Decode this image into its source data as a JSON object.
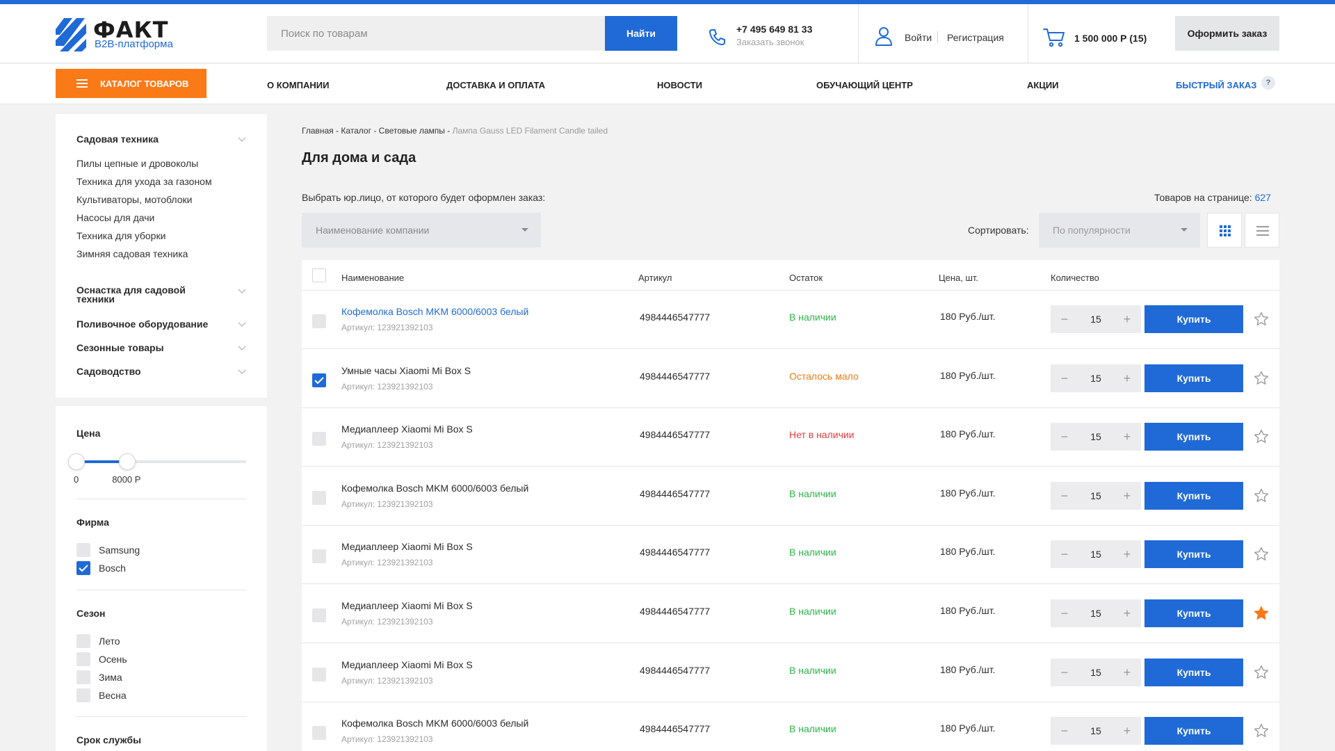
{
  "header": {
    "logo_word": "ФАКТ",
    "logo_sub": "B2B-платформа",
    "search_placeholder": "Поиск по товарам",
    "search_button": "Найти",
    "phone": "+7 495 649 81 33",
    "callback": "Заказать звонок",
    "login": "Войти",
    "register": "Регистрация",
    "cart_summary": "1 500 000 Р  (15)",
    "order_button": "Оформить заказ"
  },
  "nav": {
    "catalog_button": "КАТАЛОГ ТОВАРОВ",
    "links": [
      "О КОМПАНИИ",
      "ДОСТАВКА И ОПЛАТА",
      "НОВОСТИ",
      "ОБУЧАЮЩИЙ ЦЕНТР",
      "АКЦИИ"
    ],
    "quick_order": "БЫСТРЫЙ ЗАКАЗ",
    "quick_help": "?"
  },
  "sidebar": {
    "groups": [
      {
        "label": "Садовая техника",
        "items": [
          "Пилы цепные и дровоколы",
          "Техника для ухода за газоном",
          "Культиваторы, мотоблоки",
          "Насосы для дачи",
          "Техника для уборки",
          "Зимняя садовая техника"
        ]
      },
      {
        "label": "Оснастка для садовой техники",
        "items": []
      },
      {
        "label": "Поливочное оборудование",
        "items": []
      },
      {
        "label": "Сезонные товары",
        "items": []
      },
      {
        "label": "Садоводство",
        "items": []
      }
    ]
  },
  "filters": {
    "price_title": "Цена",
    "price_min": "0",
    "price_max": "8000 Р",
    "price_range_fraction": [
      0,
      0.3
    ],
    "brand_title": "Фирма",
    "brands": [
      {
        "label": "Samsung",
        "checked": false
      },
      {
        "label": "Bosch",
        "checked": true
      }
    ],
    "season_title": "Сезон",
    "seasons": [
      {
        "label": "Лето",
        "checked": false
      },
      {
        "label": "Осень",
        "checked": false
      },
      {
        "label": "Зима",
        "checked": false
      },
      {
        "label": "Весна",
        "checked": false
      }
    ],
    "lifetime_title": "Срок службы"
  },
  "main": {
    "breadcrumbs": [
      "Главная",
      "Каталог",
      "Световые лампы"
    ],
    "breadcrumb_current": "Лампа Gauss LED Filament Candle tailed",
    "title": "Для дома и сада",
    "company_label": "Выбрать юр.лицо, от которого будет оформлен заказ:",
    "company_placeholder": "Наименование компании",
    "per_page_label": "Товаров на странице:",
    "per_page_value": "627",
    "sort_label": "Сортировать:",
    "sort_value": "По популярности"
  },
  "table": {
    "headers": {
      "name": "Наименование",
      "sku": "Артикул",
      "stock": "Остаток",
      "price": "Цена, шт.",
      "qty": "Количество"
    },
    "buy_label": "Купить",
    "rows": [
      {
        "name": "Кофемолка Bosch MKM 6000/6003 белый",
        "sku_line": "Артикул: 123921392103",
        "article": "4984446547777",
        "stock": "В наличии",
        "stock_status": "ok",
        "price": "180 Руб./шт.",
        "qty": "15",
        "checked": false,
        "favorite": false,
        "link": true
      },
      {
        "name": "Умные часы Xiaomi Mi Box S",
        "sku_line": "Артикул: 123921392103",
        "article": "4984446547777",
        "stock": "Осталось мало",
        "stock_status": "low",
        "price": "180 Руб./шт.",
        "qty": "15",
        "checked": true,
        "favorite": false,
        "link": false
      },
      {
        "name": "Медиаплеер Xiaomi Mi Box S",
        "sku_line": "Артикул: 123921392103",
        "article": "4984446547777",
        "stock": "Нет в наличии",
        "stock_status": "no",
        "price": "180 Руб./шт.",
        "qty": "15",
        "checked": false,
        "favorite": false,
        "link": false
      },
      {
        "name": "Кофемолка Bosch MKM 6000/6003 белый",
        "sku_line": "Артикул: 123921392103",
        "article": "4984446547777",
        "stock": "В наличии",
        "stock_status": "ok",
        "price": "180 Руб./шт.",
        "qty": "15",
        "checked": false,
        "favorite": false,
        "link": false
      },
      {
        "name": "Медиаплеер Xiaomi Mi Box S",
        "sku_line": "Артикул: 123921392103",
        "article": "4984446547777",
        "stock": "В наличии",
        "stock_status": "ok",
        "price": "180 Руб./шт.",
        "qty": "15",
        "checked": false,
        "favorite": false,
        "link": false
      },
      {
        "name": "Медиаплеер Xiaomi Mi Box S",
        "sku_line": "Артикул: 123921392103",
        "article": "4984446547777",
        "stock": "В наличии",
        "stock_status": "ok",
        "price": "180 Руб./шт.",
        "qty": "15",
        "checked": false,
        "favorite": true,
        "link": false
      },
      {
        "name": "Медиаплеер Xiaomi Mi Box S",
        "sku_line": "Артикул: 123921392103",
        "article": "4984446547777",
        "stock": "В наличии",
        "stock_status": "ok",
        "price": "180 Руб./шт.",
        "qty": "15",
        "checked": false,
        "favorite": false,
        "link": false
      },
      {
        "name": "Кофемолка Bosch MKM 6000/6003 белый",
        "sku_line": "Артикул: 123921392103",
        "article": "4984446547777",
        "stock": "В наличии",
        "stock_status": "ok",
        "price": "180 Руб./шт.",
        "qty": "15",
        "checked": false,
        "favorite": false,
        "link": false
      }
    ]
  },
  "colors": {
    "brand_blue": "#1f6ad6",
    "accent_orange": "#fa7a18",
    "stock_ok": "#2bb548",
    "stock_low": "#f07b16",
    "stock_no": "#e83a3a"
  },
  "icons": [
    "logo-stripes-icon",
    "phone-icon",
    "user-icon",
    "cart-icon",
    "burger-icon",
    "chevron-down-icon",
    "checkmark-icon",
    "grid-view-icon",
    "list-view-icon",
    "star-icon"
  ]
}
